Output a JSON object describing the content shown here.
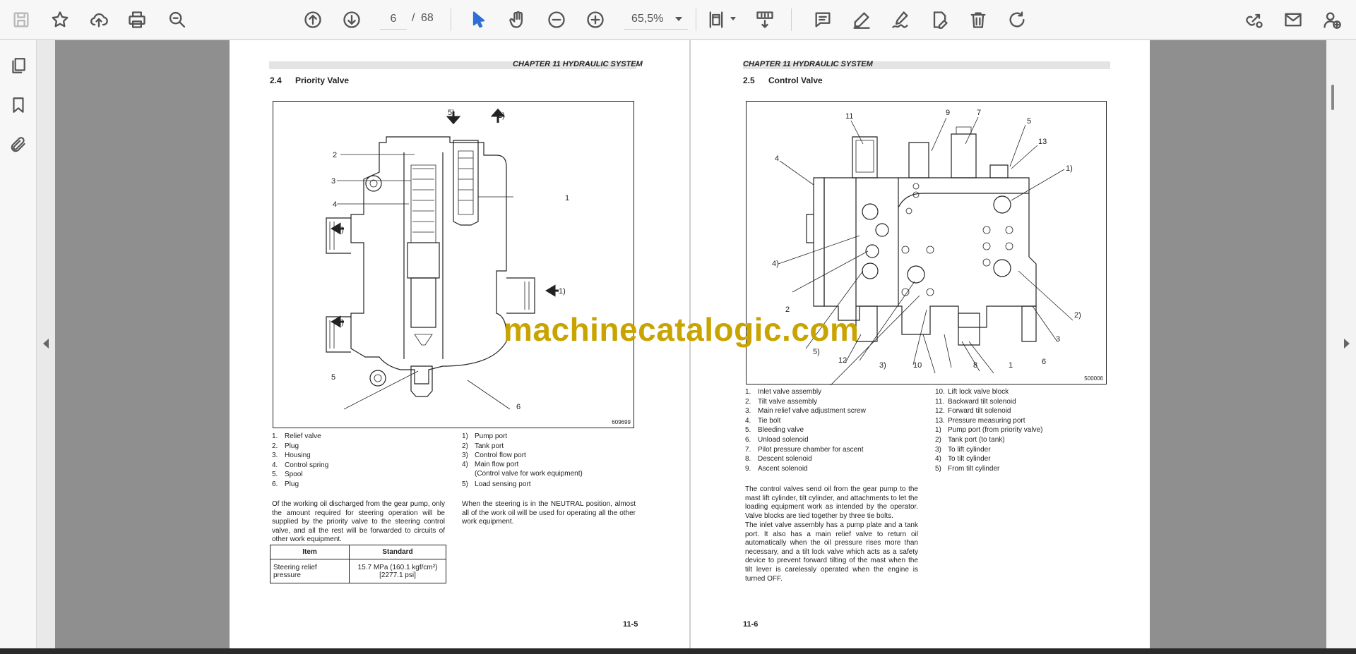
{
  "toolbar": {
    "current_page": "6",
    "page_separator": "/",
    "total_pages": "68",
    "zoom": "65,5%"
  },
  "colors": {
    "accent": "#2d6fd6",
    "watermark": "#c9a400",
    "doc_background": "#8f8f8f"
  },
  "icons": [
    "save-icon",
    "bookmark-star-icon",
    "cloud-upload-icon",
    "print-icon",
    "zoom-search-icon",
    "page-up-icon",
    "page-down-icon",
    "select-cursor-icon",
    "hand-pan-icon",
    "zoom-out-icon",
    "zoom-in-icon",
    "fit-page-icon",
    "scroll-mode-icon",
    "comment-icon",
    "highlight-pen-icon",
    "sign-icon",
    "edit-pdf-icon",
    "delete-icon",
    "rotate-icon",
    "share-link-icon",
    "email-icon",
    "add-user-icon",
    "thumbnails-icon",
    "bookmarks-icon",
    "attachments-icon"
  ],
  "watermark": "machinecatalogic.com",
  "left_page": {
    "chapter": "CHAPTER 11 HYDRAULIC SYSTEM",
    "section_number": "2.4",
    "section_title": "Priority Valve",
    "figure_id": "609699",
    "callouts": {
      "c5p": "5)",
      "c2p": "2)",
      "c2": "2",
      "c3": "3",
      "c4": "4",
      "c4p": "4)",
      "c1": "1",
      "c1p": "1)",
      "c3p": "3)",
      "c5": "5",
      "c6": "6"
    },
    "parts": [
      {
        "k": "1.",
        "v": "Relief valve"
      },
      {
        "k": "2.",
        "v": "Plug"
      },
      {
        "k": "3.",
        "v": "Housing"
      },
      {
        "k": "4.",
        "v": "Control spring"
      },
      {
        "k": "5.",
        "v": "Spool"
      },
      {
        "k": "6.",
        "v": "Plug"
      }
    ],
    "ports": [
      {
        "k": "1)",
        "v": "Pump port"
      },
      {
        "k": "2)",
        "v": "Tank port"
      },
      {
        "k": "3)",
        "v": "Control flow port"
      },
      {
        "k": "4)",
        "v": "Main flow port"
      },
      {
        "k": "",
        "v": "(Control valve for work equipment)"
      },
      {
        "k": "5)",
        "v": "Load sensing port"
      }
    ],
    "para1": "Of the working oil discharged from the gear pump, only the amount required for steering operation will be supplied by the priority valve to the steering control valve, and all the rest will be forwarded to circuits of other work equipment.",
    "para2": "When the steering is in the NEUTRAL position, almost all of the work oil will be used for operating all the other work equipment.",
    "table": {
      "header_item": "Item",
      "header_standard": "Standard",
      "row_item": "Steering relief pressure",
      "row_value_1": "15.7 MPa (160.1 kgf/cm²)",
      "row_value_2": "[2277.1 psi]"
    },
    "page_number": "11-5"
  },
  "right_page": {
    "chapter": "CHAPTER 11 HYDRAULIC SYSTEM",
    "section_number": "2.5",
    "section_title": "Control Valve",
    "figure_id": "500006",
    "callouts": {
      "c11": "11",
      "c9": "9",
      "c7": "7",
      "c5": "5",
      "c13": "13",
      "c4": "4",
      "c1p": "1)",
      "c4p": "4)",
      "c2": "2",
      "c2p": "2)",
      "c5p": "5)",
      "c3": "3",
      "c12": "12",
      "c3p": "3)",
      "c10": "10",
      "c8": "8",
      "c1": "1",
      "c6": "6"
    },
    "parts_left": [
      {
        "k": "1.",
        "v": "Inlet valve assembly"
      },
      {
        "k": "2.",
        "v": "Tilt valve assembly"
      },
      {
        "k": "3.",
        "v": "Main relief valve adjustment screw"
      },
      {
        "k": "4.",
        "v": "Tie bolt"
      },
      {
        "k": "5.",
        "v": "Bleeding valve"
      },
      {
        "k": "6.",
        "v": "Unload solenoid"
      },
      {
        "k": "7.",
        "v": "Pilot pressure chamber for ascent"
      },
      {
        "k": "8.",
        "v": "Descent solenoid"
      },
      {
        "k": "9.",
        "v": "Ascent solenoid"
      }
    ],
    "parts_right": [
      {
        "k": "10.",
        "v": "Lift lock valve block"
      },
      {
        "k": "11.",
        "v": "Backward tilt solenoid"
      },
      {
        "k": "12.",
        "v": "Forward tilt solenoid"
      },
      {
        "k": "13.",
        "v": "Pressure measuring port"
      },
      {
        "k": "1)",
        "v": "Pump port (from priority valve)"
      },
      {
        "k": "2)",
        "v": "Tank port (to tank)"
      },
      {
        "k": "3)",
        "v": "To lift cylinder"
      },
      {
        "k": "4)",
        "v": "To tilt cylinder"
      },
      {
        "k": "5)",
        "v": "From tilt cylinder"
      }
    ],
    "para1": "The control valves send oil from the gear pump to the mast lift cylinder, tilt cylinder, and attachments to let the loading equipment work as intended by the operator. Valve blocks are tied together by three tie bolts.",
    "para2": "The inlet valve assembly has a pump plate and a tank port. It also has a main relief valve to return oil automatically when the oil pressure rises more than necessary, and a tilt lock valve which acts as a safety device to prevent forward tilting of the mast when the tilt lever is carelessly operated when the engine is turned OFF.",
    "page_number": "11-6"
  }
}
